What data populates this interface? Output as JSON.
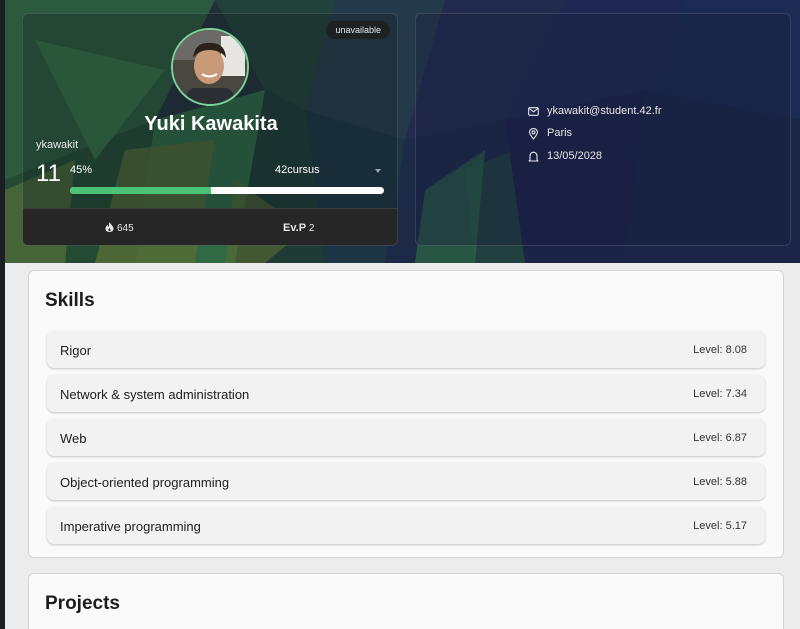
{
  "profile": {
    "status": "unavailable",
    "full_name": "Yuki Kawakita",
    "login": "ykawakit",
    "level": "11",
    "level_percent_label": "45%",
    "level_progress": 0.45,
    "cursus": "42cursus",
    "wallet": "645",
    "eval_points_label": "Ev.P",
    "eval_points": "2"
  },
  "info": {
    "email": "ykawakit@student.42.fr",
    "location": "Paris",
    "date": "13/05/2028"
  },
  "skills": {
    "title": "Skills",
    "items": [
      {
        "name": "Rigor",
        "level": "Level: 8.08"
      },
      {
        "name": "Network & system administration",
        "level": "Level: 7.34"
      },
      {
        "name": "Web",
        "level": "Level: 6.87"
      },
      {
        "name": "Object-oriented programming",
        "level": "Level: 5.88"
      },
      {
        "name": "Imperative programming",
        "level": "Level: 5.17"
      }
    ]
  },
  "projects": {
    "title": "Projects"
  },
  "colors": {
    "progress_fill": "#4cc276",
    "avatar_ring": "#7ad39a"
  },
  "icons": {
    "wallet": "flame-icon",
    "email": "mail-icon",
    "location": "map-pin-icon",
    "date": "bell-icon"
  }
}
